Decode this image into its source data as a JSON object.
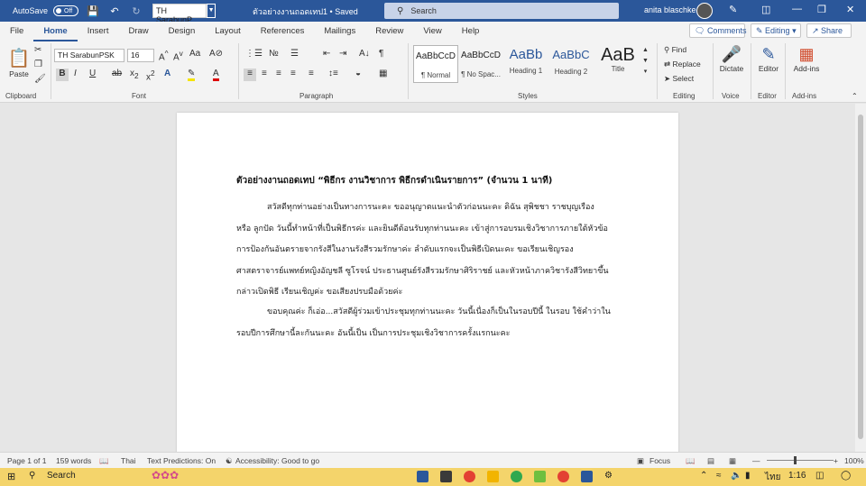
{
  "titlebar": {
    "autosave_label": "AutoSave",
    "autosave_state": "Off",
    "font_name": "TH SarabunP",
    "doc_title": "ตัวอย่างงานถอดเทป1 • Saved",
    "search_placeholder": "Search",
    "user_name": "anita blaschke"
  },
  "menu": {
    "tabs": [
      "File",
      "Home",
      "Insert",
      "Draw",
      "Design",
      "Layout",
      "References",
      "Mailings",
      "Review",
      "View",
      "Help"
    ],
    "comments": "Comments",
    "editing": "Editing",
    "share": "Share"
  },
  "ribbon": {
    "paste": "Paste",
    "font_name": "TH SarabunPSK",
    "font_size": "16",
    "find": "Find",
    "replace": "Replace",
    "select": "Select",
    "dictate": "Dictate",
    "editor": "Editor",
    "addins": "Add-ins",
    "styles": [
      {
        "preview": "AaBbCcD",
        "name": "¶ Normal"
      },
      {
        "preview": "AaBbCcD",
        "name": "¶ No Spac..."
      },
      {
        "preview": "AaBb",
        "name": "Heading 1"
      },
      {
        "preview": "AaBbC",
        "name": "Heading 2"
      },
      {
        "preview": "AaB",
        "name": "Title"
      }
    ],
    "groups": {
      "clipboard": "Clipboard",
      "font": "Font",
      "paragraph": "Paragraph",
      "styles": "Styles",
      "editing": "Editing",
      "voice": "Voice",
      "editor": "Editor",
      "addins": "Add-ins"
    }
  },
  "document": {
    "heading": "ตัวอย่างงานถอดเทป “พิธีกร งานวิชาการ พิธีกรดำเนินรายการ” (จำนวน 1 นาที)",
    "para1": [
      "สวัสดีทุกท่านอย่างเป็นทางการนะคะ ขออนุญาตแนะนำตัวก่อนนะคะ ดิฉัน สุพิชชา ราชบุญเรือง",
      "หรือ ลูกปัด วันนี้ทำหน้าที่เป็นพิธีกรค่ะ และยินดีต้อนรับทุกท่านนะคะ เข้าสู่การอบรมเชิงวิชาการภายใต้หัวข้อ",
      "การป้องกันอันตรายจากรังสีในงานรังสีรวมรักษาค่ะ ลำดับแรกจะเป็นพิธีเปิดนะคะ ขอเรียนเชิญรอง",
      "ศาสตราจารย์แพทย์หญิงอัญชลี ซูโรจน์ ประธานศูนย์รังสีรวมรักษาศิริราชย์ และหัวหน้าภาควิชารังสีวิทยาขึ้น",
      "กล่าวเปิดพิธี เรียนเชิญค่ะ ขอเสียงปรบมือด้วยค่ะ"
    ],
    "para2": [
      "ขอบคุณค่ะ ก็เอ่อ...สวัสดีผู้ร่วมเข้าประชุมทุกท่านนะคะ วันนี้เนื่องก็เป็นในรอบปีนี้ ในรอบ ใช้คำว่าใน",
      "รอบปีการศึกษานี้ละกันนะคะ อันนี้เป็น เป็นการประชุมเชิงวิชาการครั้งแรกนะคะ"
    ]
  },
  "status": {
    "page": "Page 1 of 1",
    "words": "159 words",
    "language": "Thai",
    "predictions": "Text Predictions: On",
    "accessibility": "Accessibility: Good to go",
    "focus": "Focus",
    "zoom": "100%"
  },
  "taskbar": {
    "search": "Search",
    "lang": "ไทย",
    "time": "1:16"
  }
}
